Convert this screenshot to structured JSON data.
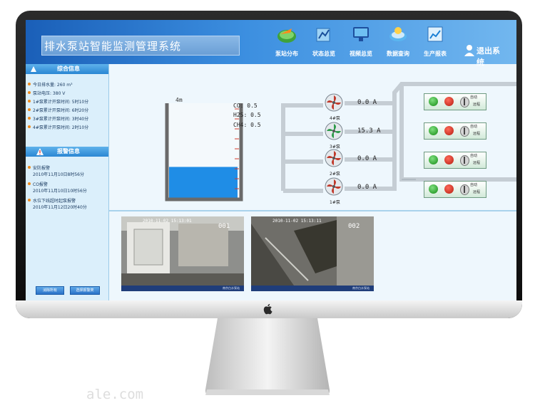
{
  "app": {
    "title": "排水泵站智能监测管理系统"
  },
  "nav": {
    "items": [
      {
        "label": "泵站分布"
      },
      {
        "label": "状态总览"
      },
      {
        "label": "视频总览"
      },
      {
        "label": "数据查询"
      },
      {
        "label": "生产报表"
      }
    ],
    "exit_label": "退出系统"
  },
  "sidebar": {
    "summary_title": "综合信息",
    "summary_items": [
      {
        "label": "今日排水量: 260 m³"
      },
      {
        "label": "泵站电压: 380 V"
      },
      {
        "label": "1#泵累计开泵时间: 5时10分"
      },
      {
        "label": "2#泵累计开泵时间: 6时20分"
      },
      {
        "label": "3#泵累计开泵时间: 3时40分"
      },
      {
        "label": "4#泵累计开泵时间: 2时10分"
      }
    ],
    "alarm_title": "报警信息",
    "alarm_items": [
      {
        "label": "安防报警",
        "time": "2010年11月10日8时56分"
      },
      {
        "label": "CO报警",
        "time": "2010年11月10日10时56分"
      },
      {
        "label": "水位下线超时起泵报警",
        "time": "2010年11月12日20时40分"
      }
    ],
    "btn_clear": "消除所有",
    "btn_select": "选择报警类"
  },
  "tank": {
    "depth_label": "4m",
    "level_fraction": 0.33
  },
  "gas": [
    {
      "label": "CO: 0.5"
    },
    {
      "label": "H2S: 0.5"
    },
    {
      "label": "CH4: 0.5"
    }
  ],
  "pumps": [
    {
      "name": "4#泵",
      "current": "0.0 A",
      "running": false
    },
    {
      "name": "3#泵",
      "current": "15.3 A",
      "running": true
    },
    {
      "name": "2#泵",
      "current": "0.0 A",
      "running": false
    },
    {
      "name": "1#泵",
      "current": "0.0 A",
      "running": false
    }
  ],
  "controls": {
    "auto_label": "自动",
    "remote_label": "远程"
  },
  "videos": [
    {
      "timestamp": "2010-11-02 15:13:01",
      "channel": "001",
      "caption": "南京白水泵站"
    },
    {
      "timestamp": "2010-11-02 15:13:11",
      "channel": "002",
      "caption": "南京白水泵站"
    }
  ],
  "watermark": "ale.com",
  "colors": {
    "water": "#1f8de6",
    "pump_stopped": "#c0392b",
    "pump_running": "#2e9b4a",
    "header": "#1a5fb8"
  }
}
